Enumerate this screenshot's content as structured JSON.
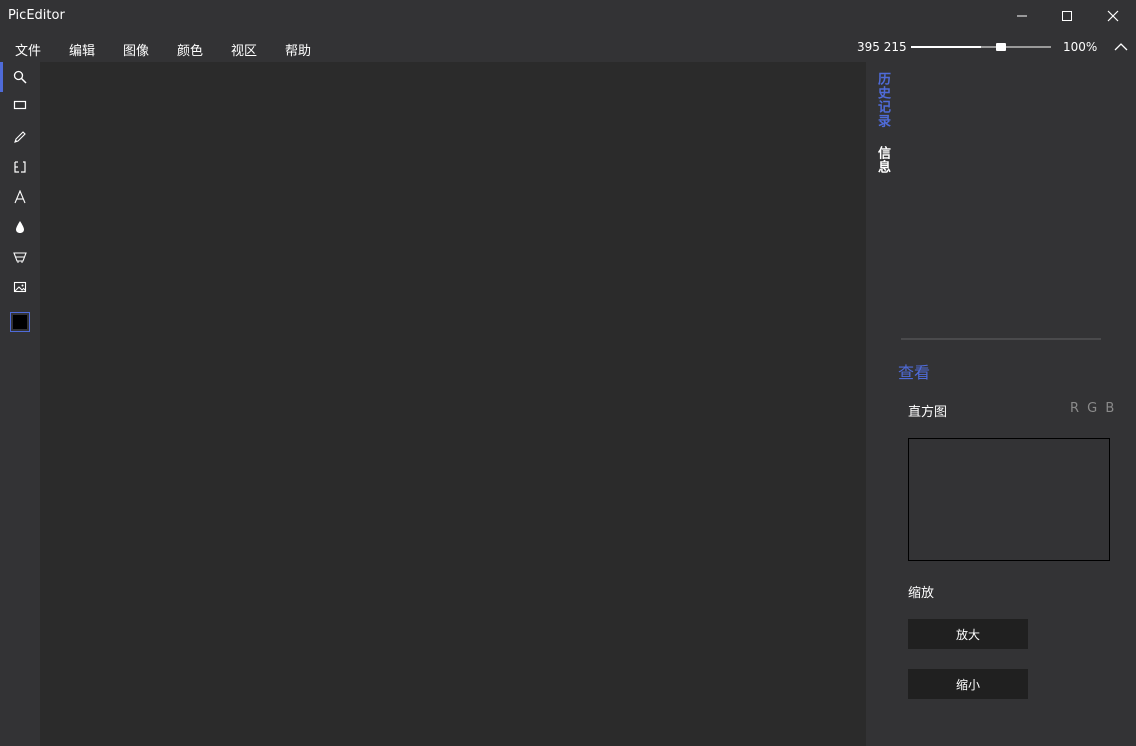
{
  "app": {
    "title": "PicEditor"
  },
  "window_controls": {
    "minimize_icon": "minimize-icon",
    "maximize_icon": "maximize-icon",
    "close_icon": "close-icon"
  },
  "menu": {
    "items": [
      {
        "label": "文件"
      },
      {
        "label": "编辑"
      },
      {
        "label": "图像"
      },
      {
        "label": "颜色"
      },
      {
        "label": "视区"
      },
      {
        "label": "帮助"
      }
    ]
  },
  "status": {
    "coordinates": "395 215",
    "zoom_level": "100%",
    "zoom_slider_value": 0.5
  },
  "toolbar": {
    "tools": [
      {
        "name": "zoom",
        "icon": "magnifier-icon",
        "active": true
      },
      {
        "name": "select",
        "icon": "rectangle-select-icon",
        "active": false
      },
      {
        "name": "brush",
        "icon": "pen-icon",
        "active": false
      },
      {
        "name": "crop",
        "icon": "crop-icon",
        "active": false
      },
      {
        "name": "text",
        "icon": "text-icon",
        "active": false
      },
      {
        "name": "fill",
        "icon": "drop-icon",
        "active": false
      },
      {
        "name": "bucket",
        "icon": "bucket-icon",
        "active": false
      },
      {
        "name": "image",
        "icon": "image-icon",
        "active": false
      }
    ],
    "current_color": "#000000"
  },
  "right_panel": {
    "tabs": [
      {
        "label": "历史记录",
        "active": true
      },
      {
        "label": "信息",
        "active": false
      }
    ],
    "section_title": "查看",
    "histogram_label": "直方图",
    "histogram_channels": "R G B",
    "zoom_section_label": "缩放",
    "zoom_in_button": "放大",
    "zoom_out_button": "缩小"
  },
  "colors": {
    "accent": "#4f6bd8",
    "background": "#333335",
    "canvas": "#2b2b2b",
    "button": "#202020"
  }
}
